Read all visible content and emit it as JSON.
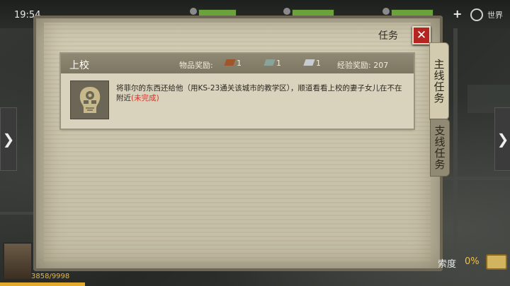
{
  "status_bar": {
    "time": "19:54",
    "world_label": "世界"
  },
  "panel": {
    "title": "任务",
    "close_symbol": "✕"
  },
  "tabs": [
    {
      "label": "主线任务"
    },
    {
      "label": "支线任务"
    }
  ],
  "quest": {
    "rank": "上校",
    "reward_label": "物品奖励:",
    "rewards": [
      {
        "icon": "brick-icon",
        "qty": "1"
      },
      {
        "icon": "cloth-icon",
        "qty": "1"
      },
      {
        "icon": "steel-icon",
        "qty": "1"
      }
    ],
    "exp_label": "经验奖励:",
    "exp_value": "207",
    "description": "将菲尔的东西还给他（用KS-23通关该城市的教学区），顺道看看上校的妻子女儿在不在附近",
    "status": "(未完成)"
  },
  "player": {
    "hp": "3858/9998"
  },
  "exploration": {
    "label": "索度",
    "value": "0%"
  },
  "colors": {
    "accent": "#b42420",
    "status": "#d2362a",
    "highlight": "#f2c14a"
  }
}
